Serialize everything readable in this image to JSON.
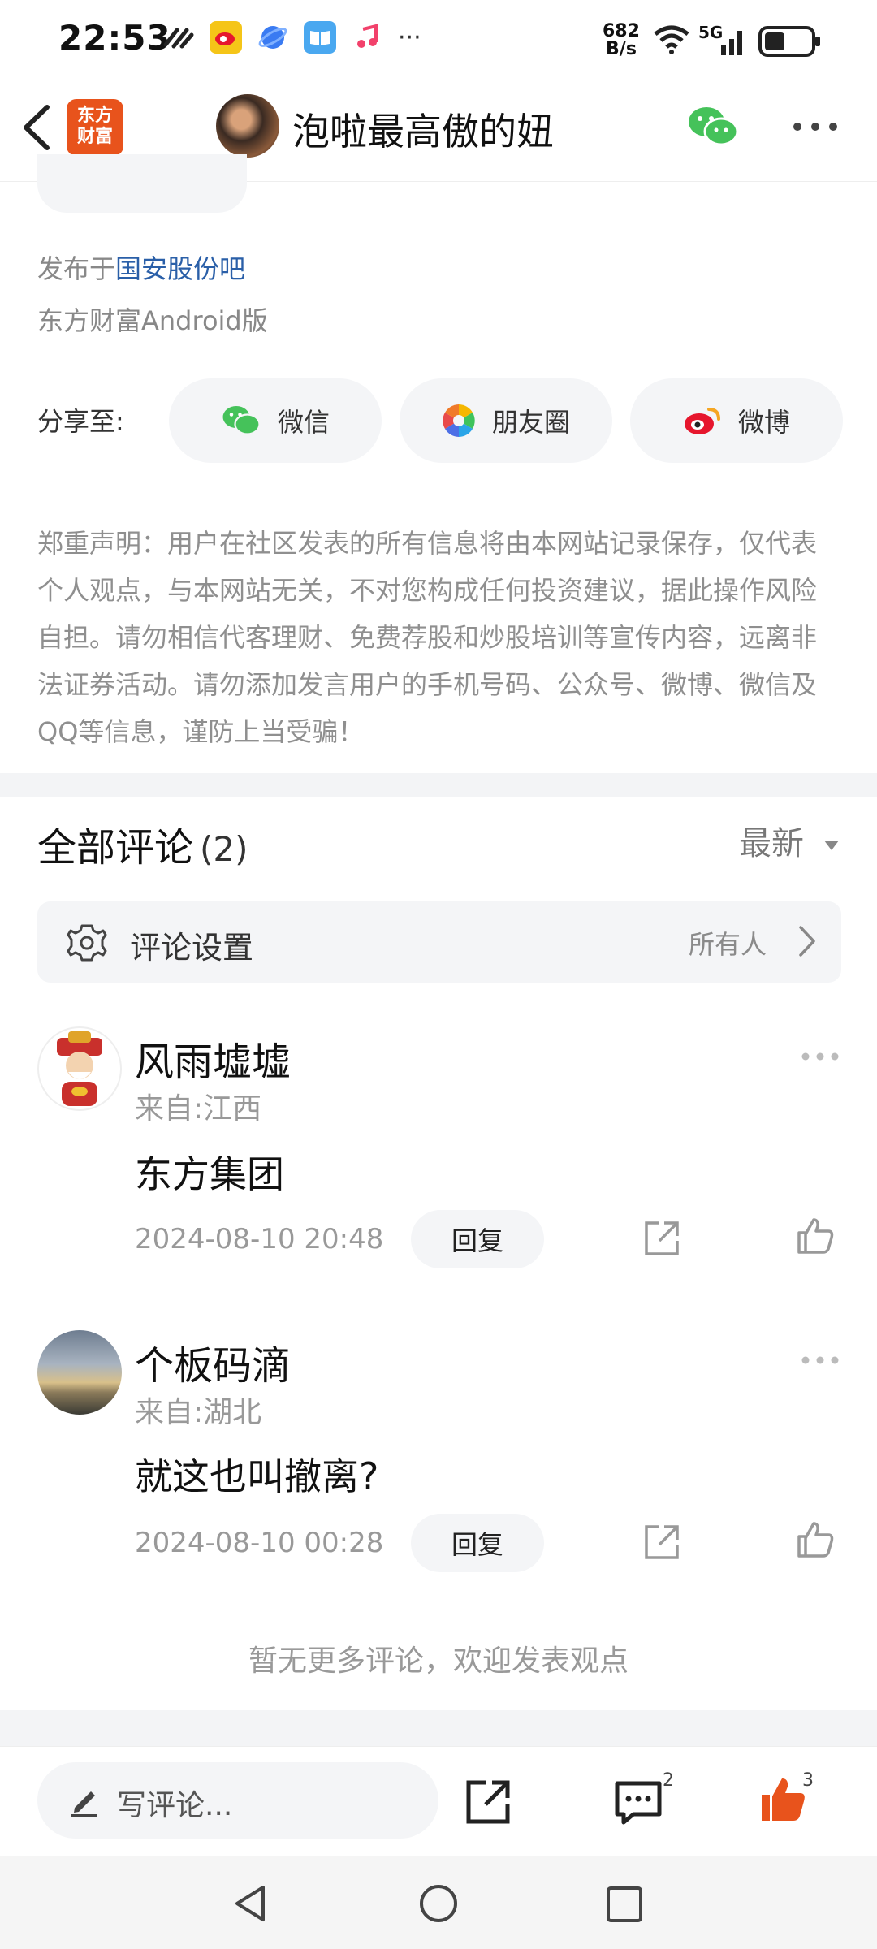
{
  "status_bar": {
    "time": "22:53",
    "speed_value": "682",
    "speed_unit": "B/s",
    "network": "5G",
    "overflow": "···"
  },
  "header": {
    "logo_text": "东方财富",
    "title": "泡啦最高傲的妞"
  },
  "post_meta": {
    "published_prefix": "发布于",
    "bar_name": "国安股份吧",
    "client": "东方财富Android版"
  },
  "share": {
    "label": "分享至:",
    "options": [
      {
        "label": "微信",
        "icon": "wechat-icon"
      },
      {
        "label": "朋友圈",
        "icon": "moments-icon"
      },
      {
        "label": "微博",
        "icon": "weibo-icon"
      }
    ]
  },
  "disclaimer": "郑重声明：用户在社区发表的所有信息将由本网站记录保存，仅代表个人观点，与本网站无关，不对您构成任何投资建议，据此操作风险自担。请勿相信代客理财、免费荐股和炒股培训等宣传内容，远离非法证券活动。请勿添加发言用户的手机号码、公众号、微博、微信及QQ等信息，谨防上当受骗！",
  "comments_section": {
    "title": "全部评论",
    "count": "(2)",
    "sort_label": "最新",
    "settings_label": "评论设置",
    "settings_value": "所有人"
  },
  "comments": [
    {
      "name": "风雨墟墟",
      "location": "来自:江西",
      "text": "东方集团",
      "date": "2024-08-10 20:48",
      "reply_label": "回复"
    },
    {
      "name": "个板码滴",
      "location": "来自:湖北",
      "text": "就这也叫撤离?",
      "date": "2024-08-10 00:28",
      "reply_label": "回复"
    }
  ],
  "no_more_text": "暂无更多评论，欢迎发表观点",
  "bottom_bar": {
    "input_placeholder": "写评论...",
    "comment_count": "2",
    "like_count": "3"
  },
  "colors": {
    "accent_orange": "#e8531c",
    "link_blue": "#2a5fa8",
    "wechat_green": "#45c25a"
  }
}
